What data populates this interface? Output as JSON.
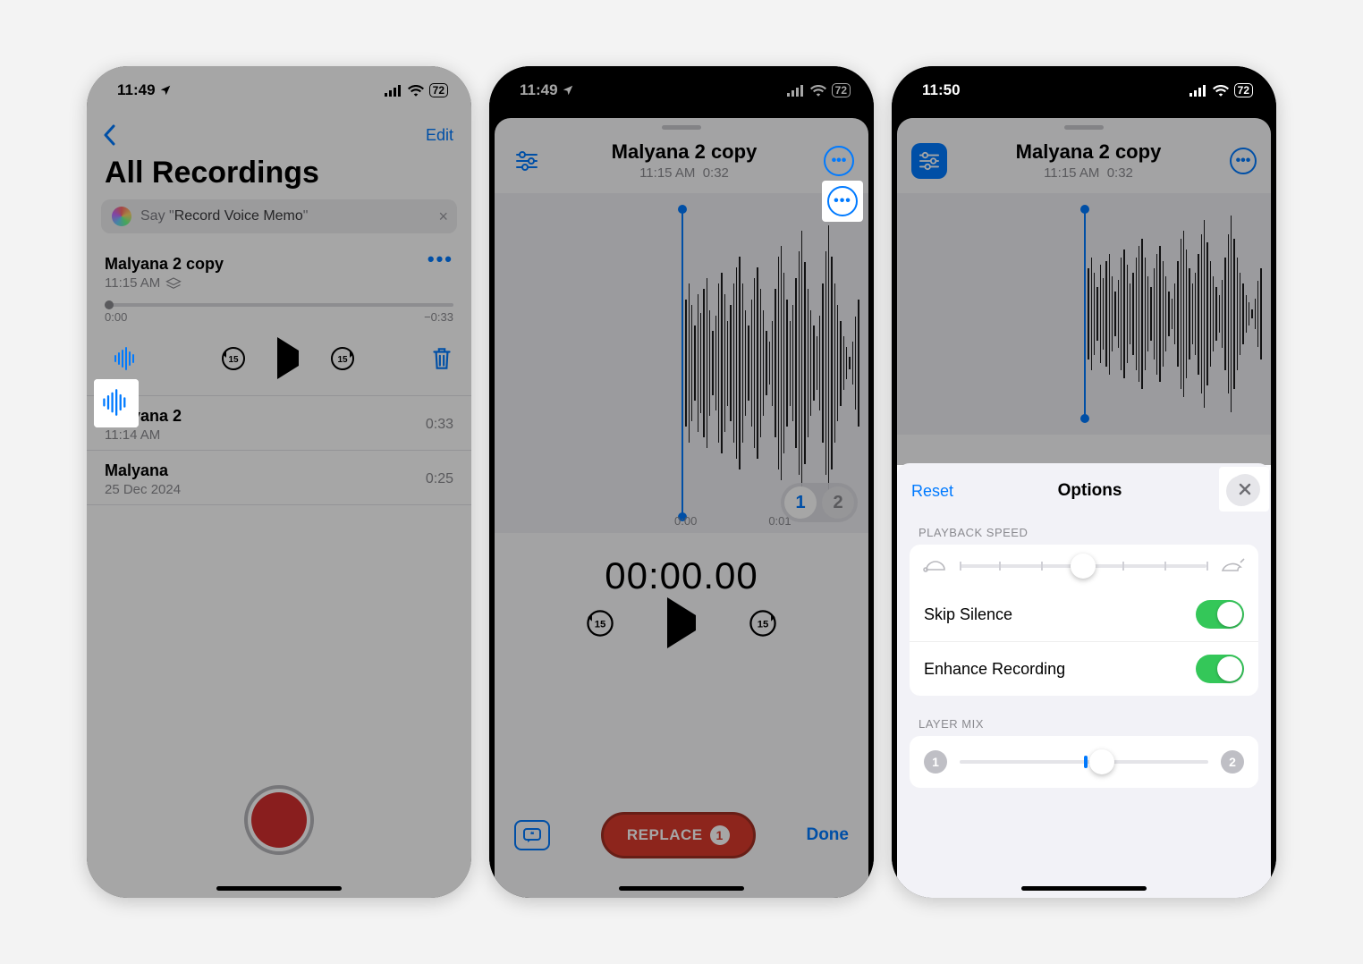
{
  "s1": {
    "status": {
      "time": "11:49",
      "battery": "72"
    },
    "edit": "Edit",
    "title": "All Recordings",
    "siri_prefix": "Say \"",
    "siri_cmd": "Record Voice Memo",
    "siri_suffix": "\"",
    "selected": {
      "title": "Malyana 2 copy",
      "time": "11:15 AM",
      "scrub_left": "0:00",
      "scrub_right": "−0:33"
    },
    "items": [
      {
        "title": "Malyana 2",
        "sub": "11:14 AM",
        "dur": "0:33"
      },
      {
        "title": "Malyana",
        "sub": "25 Dec 2024",
        "dur": "0:25"
      }
    ]
  },
  "s2": {
    "status": {
      "time": "11:49",
      "battery": "72"
    },
    "title": "Malyana 2 copy",
    "sub_time": "11:15 AM",
    "sub_dur": "0:32",
    "wave_labels": [
      "0:00",
      "0:01"
    ],
    "layers": [
      "1",
      "2"
    ],
    "bigtime": "00:00.00",
    "replace": "REPLACE",
    "replace_badge": "1",
    "done": "Done"
  },
  "s3": {
    "status": {
      "time": "11:50",
      "battery": "72"
    },
    "title": "Malyana 2 copy",
    "sub_time": "11:15 AM",
    "sub_dur": "0:32",
    "reset": "Reset",
    "options": "Options",
    "sect_speed": "Playback Speed",
    "skip": "Skip Silence",
    "enhance": "Enhance Recording",
    "sect_mix": "Layer Mix",
    "mix_left": "1",
    "mix_right": "2"
  },
  "waveform_heights": [
    12,
    40,
    88,
    120,
    150,
    110,
    70,
    130,
    95,
    140,
    160,
    100,
    60,
    90,
    150,
    170,
    130,
    80,
    110,
    150,
    180,
    200,
    150,
    100,
    70,
    120,
    160,
    180,
    140,
    100,
    60,
    40,
    80,
    140,
    200,
    220,
    170,
    120,
    80,
    110,
    160,
    210,
    250,
    190,
    140,
    100,
    70,
    50,
    90,
    150,
    210,
    260,
    200,
    150,
    110,
    80,
    50,
    30
  ]
}
